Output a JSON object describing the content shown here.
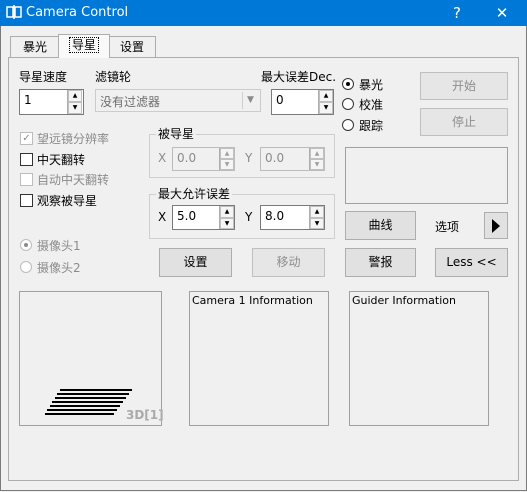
{
  "window": {
    "title": "Camera Control",
    "help": "?",
    "close": "✕"
  },
  "tabs": [
    {
      "label": "暴光"
    },
    {
      "label": "导星"
    },
    {
      "label": "设置"
    }
  ],
  "guide": {
    "guide_speed_label": "导星速度",
    "guide_speed_value": "1",
    "filter_wheel_label": "滤镜轮",
    "filter_wheel_value": "没有过滤器",
    "max_dec_label": "最大误差Dec.",
    "max_dec_value": "0",
    "telescope_res_label": "望远镜分辨率",
    "meridian_flip_label": "中天翻转",
    "auto_meridian_flip_label": "自动中天翻转",
    "watch_star_label": "观察被导星",
    "guided_group_label": "被导星",
    "guided_x_label": "X",
    "guided_x_value": "0.0",
    "guided_y_label": "Y",
    "guided_y_value": "0.0",
    "max_error_group_label": "最大允许误差",
    "err_x_label": "X",
    "err_x_value": "5.0",
    "err_y_label": "Y",
    "err_y_value": "8.0",
    "camera1_label": "摄像头1",
    "camera2_label": "摄像头2",
    "settings_button": "设置",
    "move_button": "移动"
  },
  "mode": {
    "expose_label": "暴光",
    "calibrate_label": "校准",
    "track_label": "跟踪",
    "start_button": "开始",
    "stop_button": "停止"
  },
  "right": {
    "curve_button": "曲线",
    "options_label": "选项",
    "alarm_button": "警报",
    "less_button": "Less <<"
  },
  "preview": {
    "label": "3D[1]"
  },
  "camera1_info": {
    "title": "Camera 1 Information"
  },
  "guider_info": {
    "title": "Guider Information"
  }
}
